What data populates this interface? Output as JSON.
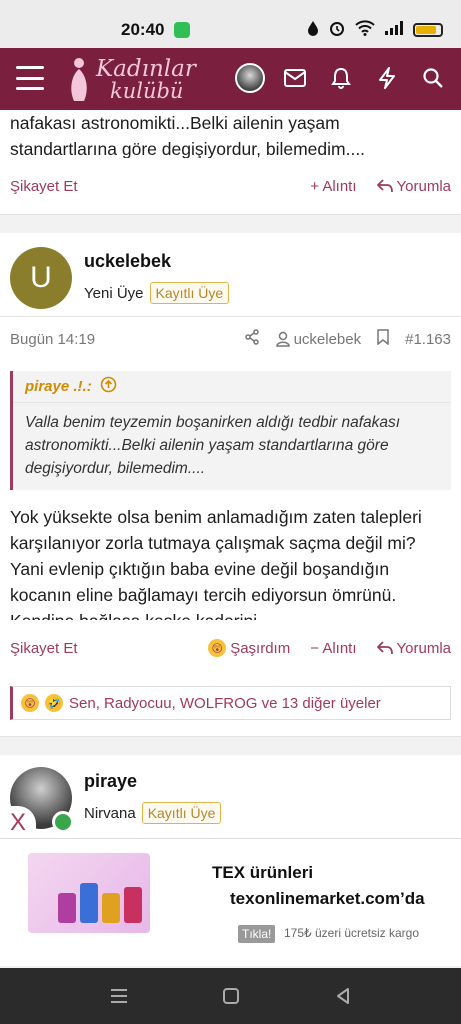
{
  "status_bar": {
    "time": "20:40",
    "battery_level": 0.85
  },
  "header": {
    "logo_line1": "Kadınlar",
    "logo_line2": "kulübü",
    "brand_color": "#7a1f3d"
  },
  "previous_post": {
    "text_tail": "nafakası astronomikti...Belki ailenin yaşam standartlarına göre degişiyordur, bilemedim....",
    "report": "Şikayet Et",
    "quote": "+ Alıntı",
    "reply": "Yorumla"
  },
  "post": {
    "avatar_letter": "U",
    "username": "uckelebek",
    "rank": "Yeni Üye",
    "badge": "Kayıtlı Üye",
    "time": "Bugün 14:19",
    "author_ref": "uckelebek",
    "number": "#1.163",
    "quote": {
      "author": "piraye .!.:",
      "text": "Valla benim teyzemin boşanirken aldığı tedbir nafakası astronomikti...Belki ailenin yaşam standartlarına göre degişiyordur, bilemedim...."
    },
    "body": "Yok yüksekte olsa benim anlamadığım zaten talepleri karşılanıyor zorla tutmaya çalışmak saçma değil mi? Yani evlenip çıktığın baba evine değil boşandığın kocanın eline bağlamayı tercih ediyorsun ömrünü. Kendine bağlasa keşke kaderini",
    "report": "Şikayet Et",
    "reaction": "Şaşırdım",
    "quote_label": "− Alıntı",
    "reply": "Yorumla",
    "reactions_summary": "Sen, Radyocuu, WOLFROG ve 13 diğer üyeler"
  },
  "next_post": {
    "username": "piraye",
    "rank": "Nirvana",
    "badge": "Kayıtlı Üye"
  },
  "ad": {
    "close": "X",
    "title": "TEX ürünleri",
    "subtitle": "texonlinemarket.com’da",
    "cta": "Tıkla!",
    "note": "175₺ üzeri ücretsiz kargo"
  }
}
